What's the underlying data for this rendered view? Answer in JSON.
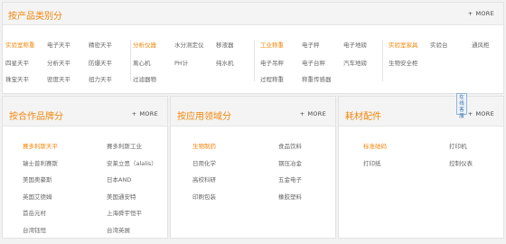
{
  "top": {
    "title": "按产品类别分",
    "more": "MORE",
    "groups": [
      {
        "cols": [
          [
            "实验室称重",
            "四星天平",
            "珠宝天平"
          ],
          [
            "电子天平",
            "分析天平",
            "密度天平"
          ],
          [
            "精密天平",
            "防爆天平",
            "扭力天平"
          ]
        ]
      },
      {
        "cols": [
          [
            "分析仪器",
            "离心机",
            "过滤器物"
          ],
          [
            "水分测定仪",
            "PH计"
          ],
          [
            "移液器",
            "纯水机"
          ]
        ]
      },
      {
        "cols": [
          [
            "工业称重",
            "电子吊秤",
            "过程称重"
          ],
          [
            "电子秤",
            "电子台秤",
            "称重传感器"
          ],
          [
            "电子地磅",
            "汽车地磅"
          ]
        ]
      },
      {
        "cols": [
          [
            "实验室家具",
            "生物安全柜"
          ],
          [
            "实验台"
          ],
          [
            "通风柜"
          ]
        ]
      }
    ]
  },
  "brands": {
    "title": "按合作品牌分",
    "more": "MORE",
    "items": [
      "赛多利斯天平",
      "赛多利斯工业",
      "瑞士普利赛斯",
      "安莱立思（alalis）",
      "美国奥豪斯",
      "日本AND",
      "英国艾德姆",
      "美国通安特",
      "首岳元村",
      "上海舜宇恒平",
      "台湾钰恒",
      "台湾英展"
    ]
  },
  "domains": {
    "title": "按应用领域分",
    "more": "MORE",
    "items": [
      "生物制药",
      "食品饮料",
      "日用化学",
      "钢压冶金",
      "高校科研",
      "五金电子",
      "印刷包装",
      "橡胶塑料"
    ]
  },
  "consumables": {
    "title": "耗材配件",
    "more": "MORE",
    "items": [
      "标准砝码",
      "打印机",
      "打印纸",
      "控制仪表"
    ]
  },
  "float": {
    "label": "在线客服"
  },
  "colors": {
    "accent": "#f0870b",
    "text": "#666666",
    "header_bg": "#f4f4f4"
  }
}
